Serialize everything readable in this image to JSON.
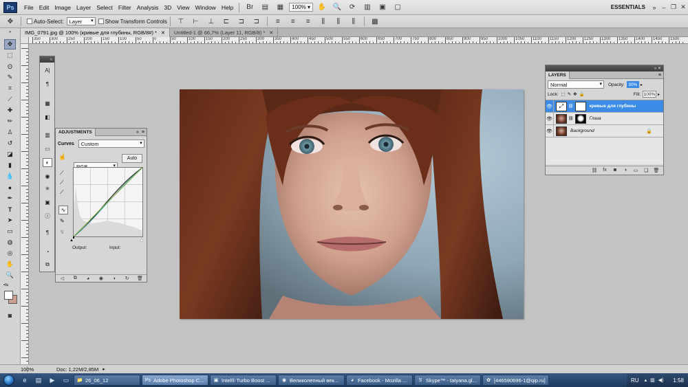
{
  "app": {
    "logo": "Ps",
    "workspace": "ESSENTIALS"
  },
  "menu": [
    "File",
    "Edit",
    "Image",
    "Layer",
    "Select",
    "Filter",
    "Analysis",
    "3D",
    "View",
    "Window",
    "Help"
  ],
  "toolbar": {
    "zoom": "100%"
  },
  "options": {
    "auto_select_label": "Auto-Select:",
    "auto_select_value": "Layer",
    "transform_label": "Show Transform Controls"
  },
  "tabs": [
    {
      "label": "IMG_0791.jpg @ 100% (кривые для глубины, RGB/8#) *",
      "active": true
    },
    {
      "label": "Untitled-1 @ 66,7% (Layer 11, RGB/8) *",
      "active": false
    }
  ],
  "ruler": [
    "350",
    "300",
    "250",
    "200",
    "150",
    "100",
    "50",
    "0",
    "50",
    "100",
    "150",
    "200",
    "250",
    "300",
    "350",
    "400",
    "450",
    "500",
    "550",
    "600",
    "650",
    "700",
    "750",
    "800",
    "850",
    "900",
    "950",
    "1000",
    "1050",
    "1100",
    "1150",
    "1200",
    "1250",
    "1300",
    "1350",
    "1400",
    "1450",
    "1500"
  ],
  "adjustments": {
    "tab": "ADJUSTMENTS",
    "curves_label": "Curves",
    "preset": "Custom",
    "channel": "RGB",
    "auto": "Auto",
    "output": "Output:",
    "input": "Input:"
  },
  "layers": {
    "tab": "LAYERS",
    "blend_mode": "Normal",
    "opacity_label": "Opacity:",
    "opacity": "30%",
    "lock_label": "Lock:",
    "fill_label": "Fill:",
    "fill": "100%",
    "items": [
      {
        "name": "кривые для глубины",
        "selected": true
      },
      {
        "name": "Глаза",
        "selected": false
      },
      {
        "name": "Background",
        "selected": false
      }
    ]
  },
  "status": {
    "zoom": "100%",
    "doc": "Doc: 1,22M/2,85M"
  },
  "taskbar": {
    "items": [
      {
        "label": "26_06_12",
        "icon": "folder-icon",
        "active": false
      },
      {
        "label": "Adobe Photoshop C...",
        "icon": "photoshop-icon",
        "active": true
      },
      {
        "label": "Intel® Turbo Boost ...",
        "icon": "intel-icon",
        "active": false
      },
      {
        "label": "Великолепный век...",
        "icon": "chrome-icon",
        "active": false
      },
      {
        "label": "Facebook - Mozilla ...",
        "icon": "firefox-icon",
        "active": false
      },
      {
        "label": "Skype™ - tatyana.gl...",
        "icon": "skype-icon",
        "active": false
      },
      {
        "label": "[446590696-1@qip.ru]",
        "icon": "qip-icon",
        "active": false
      }
    ],
    "lang": "RU",
    "time": "1:58"
  },
  "colors": {
    "accent": "#3c8be6",
    "selected_layer": "#3c8be6"
  }
}
